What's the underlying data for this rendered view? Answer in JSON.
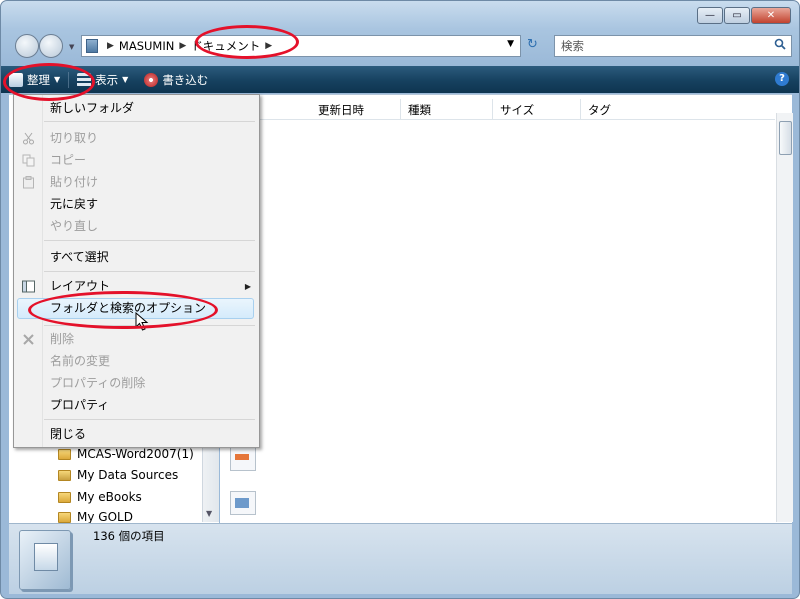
{
  "window": {
    "caption_buttons": {
      "minimize": "—",
      "maximize": "▭",
      "close": "✕"
    }
  },
  "address": {
    "crumbs": [
      "MASUMIN",
      "ドキュメント"
    ],
    "search_placeholder": "検索"
  },
  "toolbar": {
    "organize": "整理",
    "views": "表示",
    "burn": "書き込む",
    "help": "?"
  },
  "columns": [
    "更新日時",
    "種類",
    "サイズ",
    "タグ"
  ],
  "tree": [
    {
      "label": "MCAS-Word2007(1)",
      "icon": "folder-icon"
    },
    {
      "label": "My Data Sources",
      "icon": "data-folder-icon"
    },
    {
      "label": "My eBooks",
      "icon": "folder-icon"
    },
    {
      "label": "My GOLD",
      "icon": "folder-icon"
    }
  ],
  "menu": {
    "new_folder": "新しいフォルダ",
    "cut": "切り取り",
    "copy": "コピー",
    "paste": "貼り付け",
    "undo": "元に戻す",
    "redo": "やり直し",
    "select_all": "すべて選択",
    "layout": "レイアウト",
    "folder_options": "フォルダと検索のオプション",
    "delete": "削除",
    "rename": "名前の変更",
    "remove_properties": "プロパティの削除",
    "properties": "プロパティ",
    "close": "閉じる"
  },
  "status": {
    "item_count": "136 個の項目"
  },
  "colors": {
    "toolbar": "#16415f",
    "highlight": "#e4112a",
    "menu_hover": "#d5ebfb"
  }
}
